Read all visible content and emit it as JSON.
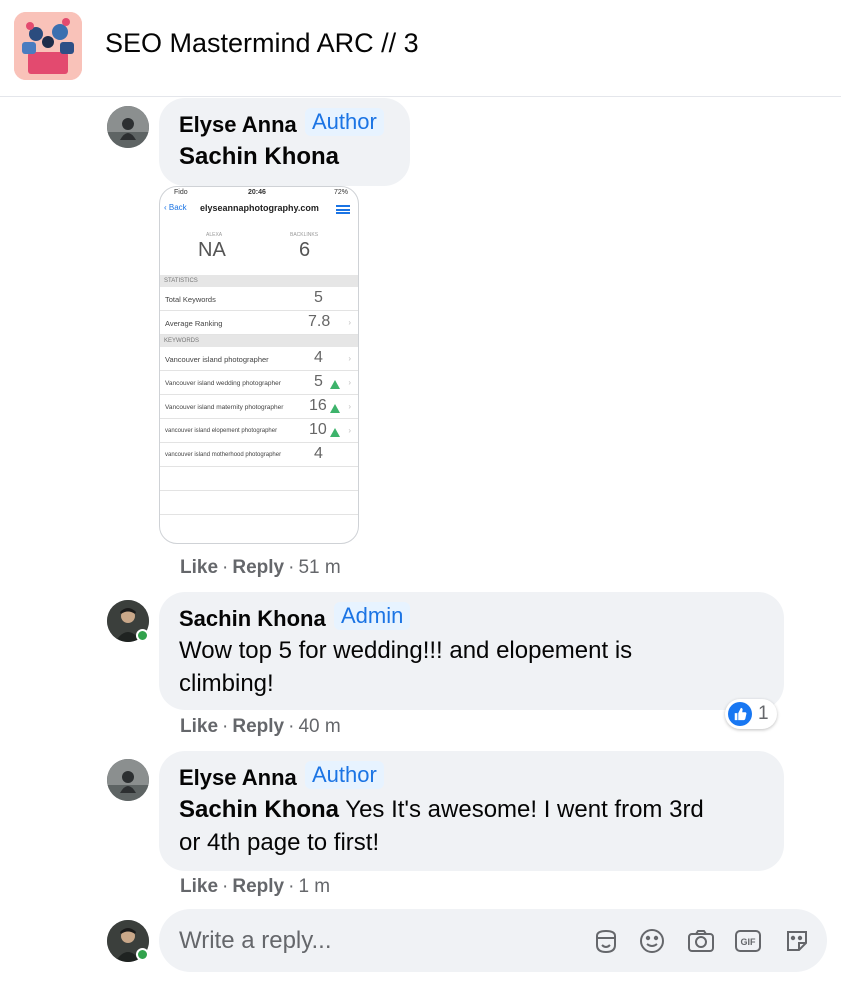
{
  "header": {
    "group_title": "SEO Mastermind ARC // 3"
  },
  "comments": [
    {
      "author": "Elyse Anna",
      "badge": "Author",
      "text_mention": "Sachin Khona",
      "text": "",
      "actions": {
        "like": "Like",
        "reply": "Reply",
        "time": "51 m"
      }
    },
    {
      "author": "Sachin Khona",
      "badge": "Admin",
      "text_line1": "Wow top 5 for wedding!!! and elopement is",
      "text_line2": "climbing!",
      "reaction_count": "1",
      "actions": {
        "like": "Like",
        "reply": "Reply",
        "time": "40 m"
      }
    },
    {
      "author": "Elyse Anna",
      "badge": "Author",
      "text_mention": "Sachin Khona",
      "text_line1": " Yes It's awesome! I went from 3rd",
      "text_line2": "or 4th page to first!",
      "actions": {
        "like": "Like",
        "reply": "Reply",
        "time": "1 m"
      }
    }
  ],
  "attachment": {
    "status_carrier": "Fido",
    "status_time": "20:46",
    "status_battery": "72%",
    "back_label": "Back",
    "domain": "elyseannaphotography.com",
    "alexa_label": "ALEXA",
    "alexa_value": "NA",
    "backlinks_label": "BACKLINKS",
    "backlinks_value": "6",
    "statistics_header": "STATISTICS",
    "stats": [
      {
        "label": "Total Keywords",
        "value": "5"
      },
      {
        "label": "Average Ranking",
        "value": "7.8"
      }
    ],
    "keywords_header": "KEYWORDS",
    "keywords": [
      {
        "label": "Vancouver island photographer",
        "value": "4",
        "up": false
      },
      {
        "label": "Vancouver island wedding photographer",
        "value": "5",
        "up": true
      },
      {
        "label": "Vancouver island maternity photographer",
        "value": "16",
        "up": true
      },
      {
        "label": "vancouver island elopement photographer",
        "value": "10",
        "up": true
      },
      {
        "label": "vancouver island motherhood photographer",
        "value": "4",
        "up": false
      }
    ]
  },
  "composer": {
    "placeholder": "Write a reply..."
  },
  "colors": {
    "accent": "#1877f2",
    "badge_text": "#1b74e4",
    "bubble": "#f0f2f5",
    "online": "#31a24c",
    "up_arrow": "#3db36b"
  },
  "icons": [
    "avatar-sticker-icon",
    "emoji-icon",
    "camera-icon",
    "gif-icon",
    "sticker-icon",
    "like-icon"
  ]
}
